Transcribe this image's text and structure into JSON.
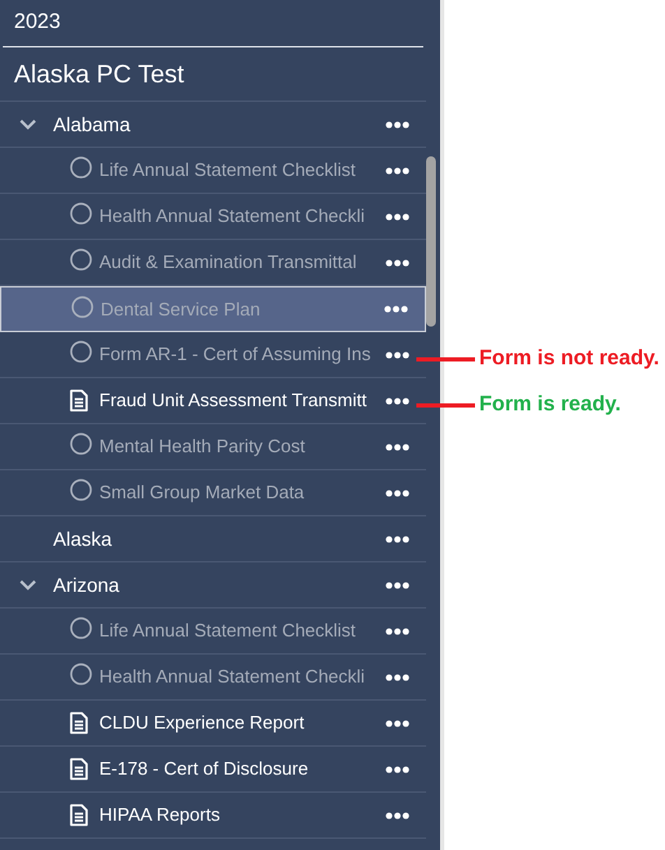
{
  "year": "2023",
  "title": "Alaska PC Test",
  "groups": [
    {
      "label": "Alabama",
      "expanded": true,
      "items": [
        {
          "label": "Life Annual Statement Checklist",
          "ready": false,
          "selected": false
        },
        {
          "label": "Health Annual Statement Checkli",
          "ready": false,
          "selected": false
        },
        {
          "label": "Audit & Examination Transmittal",
          "ready": false,
          "selected": false
        },
        {
          "label": "Dental Service Plan",
          "ready": false,
          "selected": true
        },
        {
          "label": "Form AR-1 - Cert of Assuming Ins",
          "ready": false,
          "selected": false,
          "callout": {
            "text": "Form is not ready.",
            "color": "#ed1c24"
          }
        },
        {
          "label": "Fraud Unit Assessment Transmitt",
          "ready": true,
          "selected": false,
          "callout": {
            "text": "Form is ready.",
            "color": "#22b14c"
          }
        },
        {
          "label": "Mental Health Parity Cost",
          "ready": false,
          "selected": false
        },
        {
          "label": "Small Group Market Data",
          "ready": false,
          "selected": false
        }
      ]
    },
    {
      "label": "Alaska",
      "expanded": false
    },
    {
      "label": "Arizona",
      "expanded": true,
      "items": [
        {
          "label": "Life Annual Statement Checklist",
          "ready": false,
          "selected": false
        },
        {
          "label": "Health Annual Statement Checkli",
          "ready": false,
          "selected": false
        },
        {
          "label": "CLDU Experience Report",
          "ready": true,
          "selected": false
        },
        {
          "label": "E-178 - Cert of Disclosure",
          "ready": true,
          "selected": false
        },
        {
          "label": "HIPAA Reports",
          "ready": true,
          "selected": false
        }
      ]
    }
  ]
}
